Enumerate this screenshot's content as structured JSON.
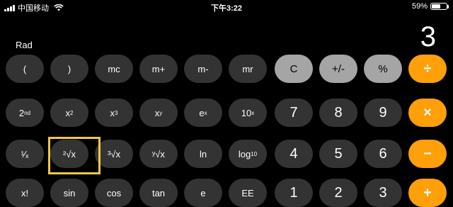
{
  "status": {
    "carrier": "中国移动",
    "time": "下午3:22",
    "battery_percent": "59%",
    "battery_level": 0.59
  },
  "calculator": {
    "angle_mode": "Rad",
    "display_value": "3",
    "accent_color": "#ff9f0a",
    "function_key_color": "#a5a5a5",
    "key_color": "#333333",
    "highlight_color": "#f3c64a"
  },
  "keys": {
    "row1": [
      "(",
      ")",
      "mc",
      "m+",
      "m-",
      "mr",
      "C",
      "+/-",
      "%",
      "÷"
    ],
    "row2": {
      "second": "2",
      "second_sup": "nd",
      "x2": "x",
      "x2_sup": "2",
      "x3": "x",
      "x3_sup": "3",
      "xy": "x",
      "xy_sup": "y",
      "ex": "e",
      "ex_sup": "x",
      "tenx": "10",
      "tenx_sup": "x",
      "seven": "7",
      "eight": "8",
      "nine": "9",
      "multiply": "×"
    },
    "row3": {
      "reciprocal": "¹⁄ₓ",
      "sqrt2": "²√x",
      "sqrt3": "³√x",
      "sqrty": "ʸ√x",
      "ln": "ln",
      "log10": "log",
      "log10_sub": "10",
      "four": "4",
      "five": "5",
      "six": "6",
      "minus": "−"
    },
    "row4": [
      "x!",
      "sin",
      "cos",
      "tan",
      "e",
      "EE",
      "1",
      "2",
      "3",
      "+"
    ]
  }
}
